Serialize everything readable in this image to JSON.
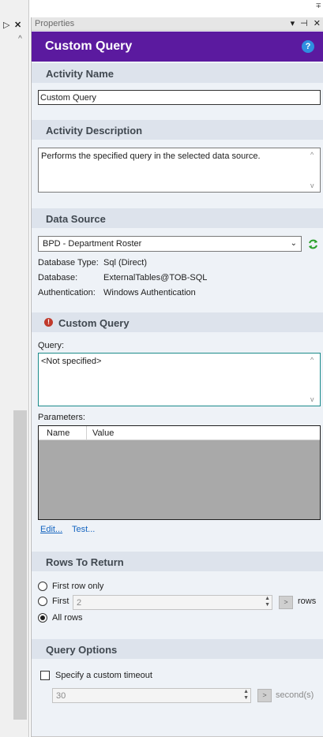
{
  "window": {
    "dock_left": "▷",
    "close_left": "✕",
    "up_arrow": "^",
    "top_right_glyph": "∓"
  },
  "properties": {
    "title": "Properties",
    "controls": "▾ ⊣ ✕"
  },
  "header": {
    "title": "Custom Query",
    "help": "?"
  },
  "activity_name": {
    "heading": "Activity Name",
    "value": "Custom Query"
  },
  "activity_description": {
    "heading": "Activity Description",
    "value": "Performs the specified query in the selected data source."
  },
  "data_source": {
    "heading": "Data Source",
    "selected": "BPD - Department Roster",
    "refresh_icon": "refresh-icon",
    "details": [
      {
        "label": "Database Type:",
        "value": "Sql (Direct)"
      },
      {
        "label": "Database:",
        "value": "ExternalTables@TOB-SQL"
      },
      {
        "label": "Authentication:",
        "value": "Windows Authentication"
      }
    ]
  },
  "custom_query": {
    "heading": "Custom Query",
    "warn_glyph": "!",
    "query_label": "Query:",
    "query_value": "<Not specified>",
    "parameters_label": "Parameters:",
    "columns": [
      "Name",
      "Value"
    ],
    "edit_link": "Edit...",
    "test_link": "Test..."
  },
  "rows_to_return": {
    "heading": "Rows To Return",
    "options": [
      "First row only",
      "First",
      "All rows"
    ],
    "selected": "All rows",
    "first_count": "2",
    "go_label": ">",
    "unit": "rows"
  },
  "query_options": {
    "heading": "Query Options",
    "timeout_label": "Specify a custom timeout",
    "timeout_checked": false,
    "timeout_value": "30",
    "go_label": ">",
    "unit": "second(s)"
  },
  "colors": {
    "header_bg": "#5b1a9f",
    "section_bg": "#dde3ec",
    "panel_bg": "#eef2f7",
    "accent_link": "#1565c0"
  }
}
